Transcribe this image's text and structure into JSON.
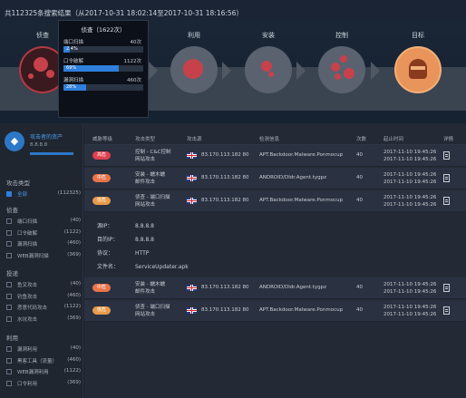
{
  "header": {
    "summary": "共112325条搜索结果（从2017-10-31 18:02:14至2017-10-31 18:16:56）"
  },
  "killchain": {
    "stages": [
      "侦查",
      "投递",
      "利用",
      "安装",
      "控制",
      "目标"
    ]
  },
  "popup": {
    "title": "侦查（1622次）",
    "items": [
      {
        "label": "端口扫描",
        "count": "40次",
        "pct_label": "2.4%",
        "pct": 0.024
      },
      {
        "label": "口令破解",
        "count": "1122次",
        "pct_label": "69%",
        "pct": 0.69
      },
      {
        "label": "漏洞扫描",
        "count": "460次",
        "pct_label": "28%",
        "pct": 0.28
      }
    ]
  },
  "asset": {
    "name": "攻击者的资产",
    "ip": "8.8.8.8"
  },
  "filters": {
    "attack_type_title": "攻击类型",
    "all": {
      "label": "全部",
      "count": "(112325)"
    },
    "recon_title": "侦查",
    "recon": [
      {
        "label": "端口扫描",
        "count": "(40)"
      },
      {
        "label": "口令破解",
        "count": "(1122)"
      },
      {
        "label": "漏洞扫描",
        "count": "(460)"
      },
      {
        "label": "WEB漏洞扫描",
        "count": "(369)"
      }
    ],
    "delivery_title": "投递",
    "delivery": [
      {
        "label": "鱼叉攻击",
        "count": "(40)"
      },
      {
        "label": "钓鱼攻击",
        "count": "(460)"
      },
      {
        "label": "恶意代码攻击",
        "count": "(1122)"
      },
      {
        "label": "水坑攻击",
        "count": "(369)"
      }
    ],
    "exploit_title": "利用",
    "exploit": [
      {
        "label": "漏洞利用",
        "count": "(40)"
      },
      {
        "label": "黑客工具（流量）",
        "count": "(460)"
      },
      {
        "label": "WEB漏洞利用",
        "count": "(1122)"
      },
      {
        "label": "口令利用",
        "count": "(369)"
      }
    ]
  },
  "table": {
    "headers": [
      "威胁等级",
      "攻击类型",
      "攻击源",
      "检测信息",
      "次数",
      "起止时间",
      "详情"
    ],
    "rows": [
      {
        "level": "高危",
        "color": "#e0404f",
        "type1": "控制 - C&C控制",
        "type2": "网站攻击",
        "src": "83.170.113.182 80",
        "rule": "APT.Backdoor.Malware.Ponmocup",
        "count": "40",
        "t1": "2017-11-10 19:45:26",
        "t2": "2017-11-10 19:45:26"
      },
      {
        "level": "中危",
        "color": "#e8744a",
        "type1": "安装 - 蠕木蠕",
        "type2": "邮件攻击",
        "src": "83.170.113.182 80",
        "rule": "ANDROID/Dldr.Agent.tygpz",
        "count": "40",
        "t1": "2017-11-10 19:45:26",
        "t2": "2017-11-10 19:45:26"
      },
      {
        "level": "低危",
        "color": "#e89a4a",
        "type1": "侦查 - 端口扫描",
        "type2": "网站攻击",
        "src": "83.170.113.182 80",
        "rule": "APT.Backdoor.Malware.Ponmocup",
        "count": "40",
        "t1": "2017-11-10 19:45:26",
        "t2": "2017-11-10 19:45:26"
      },
      {
        "level": "中危",
        "color": "#e8744a",
        "type1": "安装 - 蠕木蠕",
        "type2": "邮件攻击",
        "src": "83.170.113.182 80",
        "rule": "ANDROID/Dldr.Agent.tygpz",
        "count": "40",
        "t1": "2017-11-10 19:45:26",
        "t2": "2017-11-10 19:45:26"
      },
      {
        "level": "低危",
        "color": "#e89a4a",
        "type1": "侦查 - 端口扫描",
        "type2": "网站攻击",
        "src": "83.170.113.182 80",
        "rule": "APT.Backdoor.Malware.Ponmocup",
        "count": "40",
        "t1": "2017-11-10 19:45:26",
        "t2": "2017-11-10 19:45:26"
      }
    ],
    "expand": [
      {
        "k": "源IP：",
        "v": "8.8.8.8"
      },
      {
        "k": "目的IP：",
        "v": "8.8.8.8"
      },
      {
        "k": "协议：",
        "v": "HTTP"
      },
      {
        "k": "文件名：",
        "v": "ServiceUpdater.apk"
      }
    ]
  }
}
